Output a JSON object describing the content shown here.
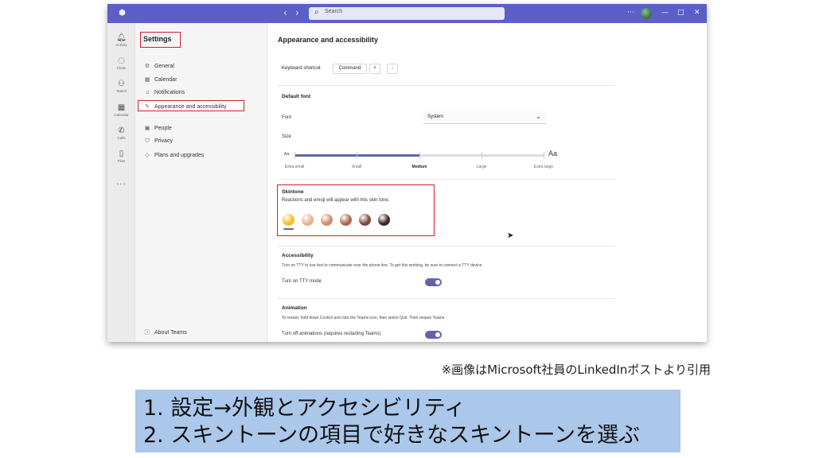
{
  "window": {
    "search_placeholder": "Search",
    "nav_back": "‹",
    "nav_forward": "›",
    "more": "···",
    "minimize": "—",
    "maximize": "□",
    "close": "✕"
  },
  "rail": {
    "items": [
      {
        "label": "Activity",
        "icon": "bell-icon"
      },
      {
        "label": "Chats",
        "icon": "chat-icon"
      },
      {
        "label": "Teams",
        "icon": "teams-icon"
      },
      {
        "label": "Calendar",
        "icon": "calendar-icon"
      },
      {
        "label": "Calls",
        "icon": "phone-icon"
      },
      {
        "label": "Files",
        "icon": "file-icon"
      }
    ],
    "more": "···"
  },
  "settings": {
    "title": "Settings",
    "items": [
      {
        "label": "General",
        "icon": "gear-icon"
      },
      {
        "label": "Calendar",
        "icon": "calendar-icon"
      },
      {
        "label": "Notifications",
        "icon": "bell-icon"
      },
      {
        "label": "Appearance and accessibility",
        "icon": "brush-icon"
      },
      {
        "label": "People",
        "icon": "people-icon"
      },
      {
        "label": "Privacy",
        "icon": "shield-icon"
      },
      {
        "label": "Plans and upgrades",
        "icon": "diamond-icon"
      }
    ],
    "about": "About Teams"
  },
  "main": {
    "title": "Appearance and accessibility",
    "keyboard": {
      "label": "Keyboard shortcut",
      "command": "Command",
      "plus": "+",
      "minus": "-"
    },
    "default_font": {
      "heading": "Default font",
      "font_label": "Font",
      "font_value": "System",
      "size_label": "Size",
      "aa_small": "Aa",
      "aa_large": "Aa",
      "sizes": [
        "Extra small",
        "Small",
        "Medium",
        "Large",
        "Extra large"
      ],
      "selected_size": "Medium"
    },
    "skintone": {
      "heading": "Skintone",
      "description": "Reactions and emoji will appear with this skin tone.",
      "tones": [
        "#f7c21a",
        "#e7b08e",
        "#cf8d69",
        "#a96a4f",
        "#7a4a3c",
        "#3d2620"
      ],
      "selected_index": 0
    },
    "accessibility": {
      "heading": "Accessibility",
      "description": "Turn on TTY to use text to communicate over the phone line. To get this working, be sure to connect a TTY device.",
      "toggle_label": "Turn on TTY mode",
      "toggle_on": true
    },
    "animation": {
      "heading": "Animation",
      "description": "To restart, hold down Control and click the Teams icon, then select Quit. Then reopen Teams.",
      "toggle_label": "Turn off animations (requires restarting Teams)",
      "toggle_on": true
    }
  },
  "caption": "※画像はMicrosoft社員のLinkedInポストより引用",
  "banner": {
    "line1": "1. 設定→外観とアクセシビリティ",
    "line2": "2. スキントーンの項目で好きなスキントーンを選ぶ"
  },
  "colors": {
    "accent": "#5b5fc7",
    "highlight_box": "#d0202a",
    "banner_bg": "#abc7ea"
  }
}
